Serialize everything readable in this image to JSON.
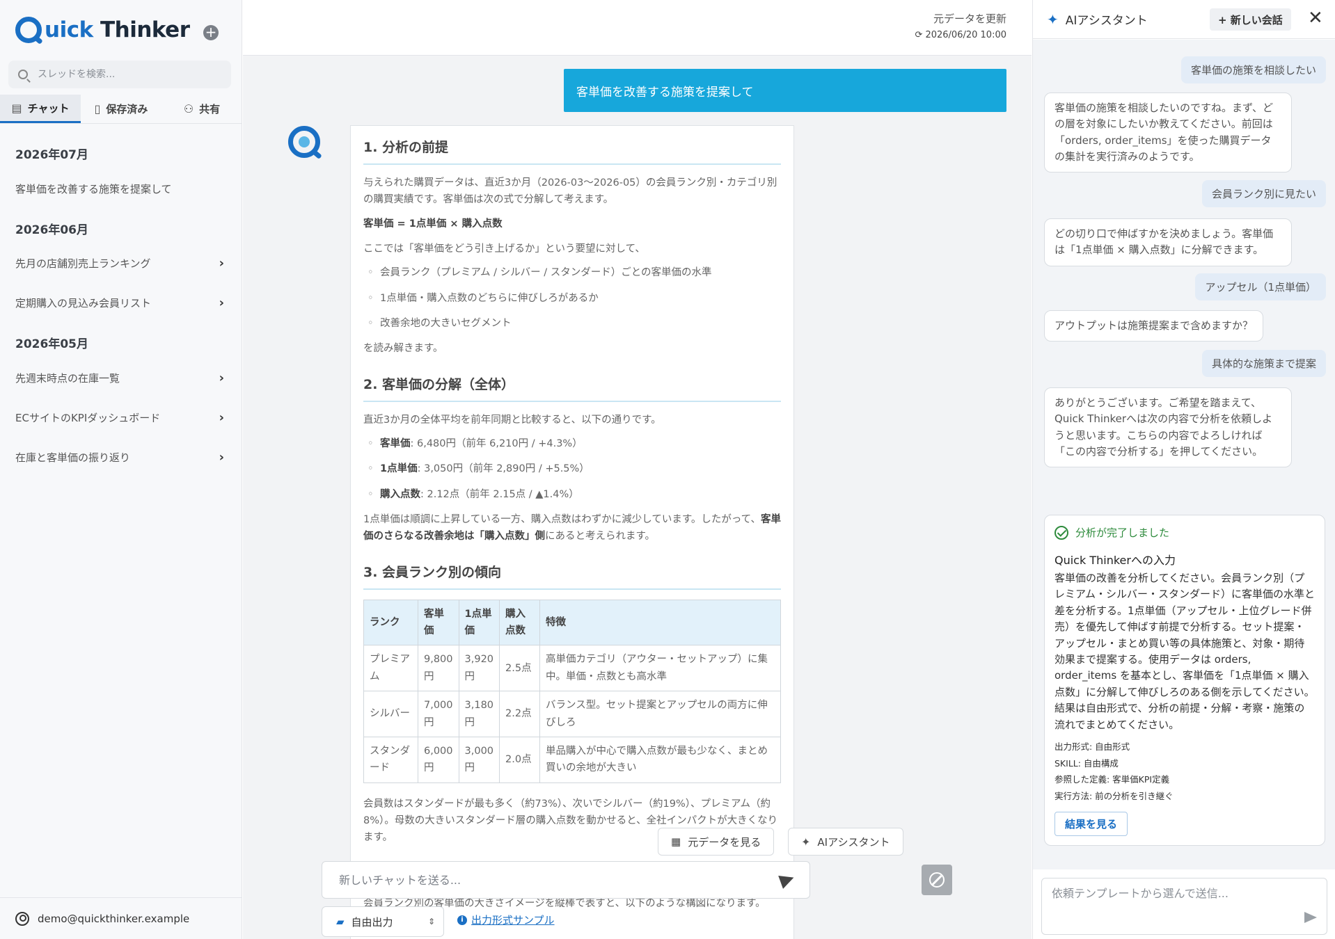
{
  "app": {
    "logo_q": "Q",
    "logo_uick": "uick",
    "logo_thinker": " Thinker"
  },
  "sidebar": {
    "search_placeholder": "スレッドを検索...",
    "tabs": [
      {
        "label": "チャット",
        "icon": "chat-icon"
      },
      {
        "label": "保存済み",
        "icon": "bookmark-icon"
      },
      {
        "label": "共有",
        "icon": "users-icon"
      }
    ],
    "sections": [
      {
        "heading": "2026年07月",
        "items": [
          {
            "label": "客単価を改善する施策を提案して",
            "chevron": false
          }
        ]
      },
      {
        "heading": "2026年06月",
        "items": [
          {
            "label": "先月の店舗別売上ランキング",
            "chevron": true
          },
          {
            "label": "定期購入の見込み会員リスト",
            "chevron": true
          }
        ]
      },
      {
        "heading": "2026年05月",
        "items": [
          {
            "label": "先週末時点の在庫一覧",
            "chevron": true
          },
          {
            "label": "ECサイトのKPIダッシュボード",
            "chevron": true
          },
          {
            "label": "在庫と客単価の振り返り",
            "chevron": true
          }
        ]
      }
    ],
    "user_email": "demo@quickthinker.example"
  },
  "main": {
    "refresh_label": "元データを更新",
    "refresh_time": "2026/06/20 10:00",
    "user_prompt": "客単価を改善する施策を提案して",
    "answer": {
      "h1": "1. 分析の前提",
      "p1": "与えられた購買データは、直近3か月（2026-03〜2026-05）の会員ランク別・カテゴリ別の購買実績です。客単価は次の式で分解して考えます。",
      "formula": "客単価 = 1点単価 × 購入点数",
      "p2": "ここでは「客単価をどう引き上げるか」という要望に対して、",
      "bullets1": [
        "会員ランク（プレミアム / シルバー / スタンダード）ごとの客単価の水準",
        "1点単価・購入点数のどちらに伸びしろがあるか",
        "改善余地の大きいセグメント"
      ],
      "p3": "を読み解きます。",
      "h2": "2. 客単価の分解（全体）",
      "p4": "直近3か月の全体平均を前年同期と比較すると、以下の通りです。",
      "bullets2": [
        {
          "key": "客単価",
          "val": ": 6,480円（前年 6,210円 / +4.3%）"
        },
        {
          "key": "1点単価",
          "val": ": 3,050円（前年 2,890円 / +5.5%）"
        },
        {
          "key": "購入点数",
          "val": ": 2.12点（前年 2.15点 / ▲1.4%）"
        }
      ],
      "p5a": "1点単価は順調に上昇している一方、購入点数はわずかに減少しています。したがって、",
      "p5b": "客単価のさらなる改善余地は「購入点数」側",
      "p5c": "にあると考えられます。",
      "h3": "3. 会員ランク別の傾向",
      "table": {
        "headers": [
          "ランク",
          "客単価",
          "1点単価",
          "購入点数",
          "特徴"
        ],
        "rows": [
          [
            "プレミアム",
            "9,800円",
            "3,920円",
            "2.5点",
            "高単価カテゴリ（アウター・セットアップ）に集中。単価・点数とも高水準"
          ],
          [
            "シルバー",
            "7,000円",
            "3,180円",
            "2.2点",
            "バランス型。セット提案とアップセルの両方に伸びしろ"
          ],
          [
            "スタンダード",
            "6,000円",
            "3,000円",
            "2.0点",
            "単品購入が中心で購入点数が最も少なく、まとめ買いの余地が大きい"
          ]
        ]
      },
      "p6": "会員数はスタンダードが最も多く（約73%）、次いでシルバー（約19%）、プレミアム（約8%）。母数の大きいスタンダード層の購入点数を動かせると、全社インパクトが大きくなります。",
      "p7": "会員ランク別の客単価の大きさイメージを縦棒で表すと、以下のような構図になります。"
    },
    "btn_view_data": "元データを見る",
    "btn_ai": "AIアシスタント",
    "chat_placeholder": "新しいチャットを送る...",
    "format_value": "自由出力",
    "sample_link": "出力形式サンプル"
  },
  "assistant": {
    "title": "AIアシスタント",
    "new_chat": "+ 新しい会話",
    "messages": [
      {
        "role": "user",
        "text": "客単価の施策を相談したい"
      },
      {
        "role": "bot",
        "text": "客単価の施策を相談したいのですね。まず、どの層を対象にしたいか教えてください。前回は「orders, order_items」を使った購買データの集計を実行済みのようです。"
      },
      {
        "role": "user",
        "text": "会員ランク別に見たい"
      },
      {
        "role": "bot",
        "text": "どの切り口で伸ばすかを決めましょう。客単価は「1点単価 × 購入点数」に分解できます。"
      },
      {
        "role": "user",
        "text": "アップセル（1点単価）"
      },
      {
        "role": "bot",
        "text": "アウトプットは施策提案まで含めますか？"
      },
      {
        "role": "user",
        "text": "具体的な施策まで提案"
      },
      {
        "role": "bot",
        "text": "ありがとうございます。ご希望を踏まえて、Quick Thinkerへは次の内容で分析を依頼しようと思います。こちらの内容でよろしければ「この内容で分析する」を押してください。"
      }
    ],
    "card": {
      "status": "分析が完了しました",
      "title": "Quick Thinkerへの入力",
      "body": "客単価の改善を分析してください。会員ランク別（プレミアム・シルバー・スタンダード）に客単価の水準と差を分析する。1点単価（アップセル・上位グレード併売）を優先して伸ばす前提で分析する。セット提案・アップセル・まとめ買い等の具体施策と、対象・期待効果まで提案する。使用データは orders, order_items を基本とし、客単価を「1点単価 × 購入点数」に分解して伸びしろのある側を示してください。結果は自由形式で、分析の前提・分解・考察・施策の流れでまとめてください。",
      "meta": [
        "出力形式: 自由形式",
        "SKILL: 自由構成",
        "参照した定義: 客単価KPI定義",
        "実行方法: 前の分析を引き継ぐ"
      ],
      "result_btn": "結果を見る"
    },
    "input_placeholder": "依頼テンプレートから選んで送信..."
  },
  "colors": {
    "brand": "#1a6fc4",
    "prompt_bg": "#17a7db",
    "success": "#2e8b3c"
  }
}
